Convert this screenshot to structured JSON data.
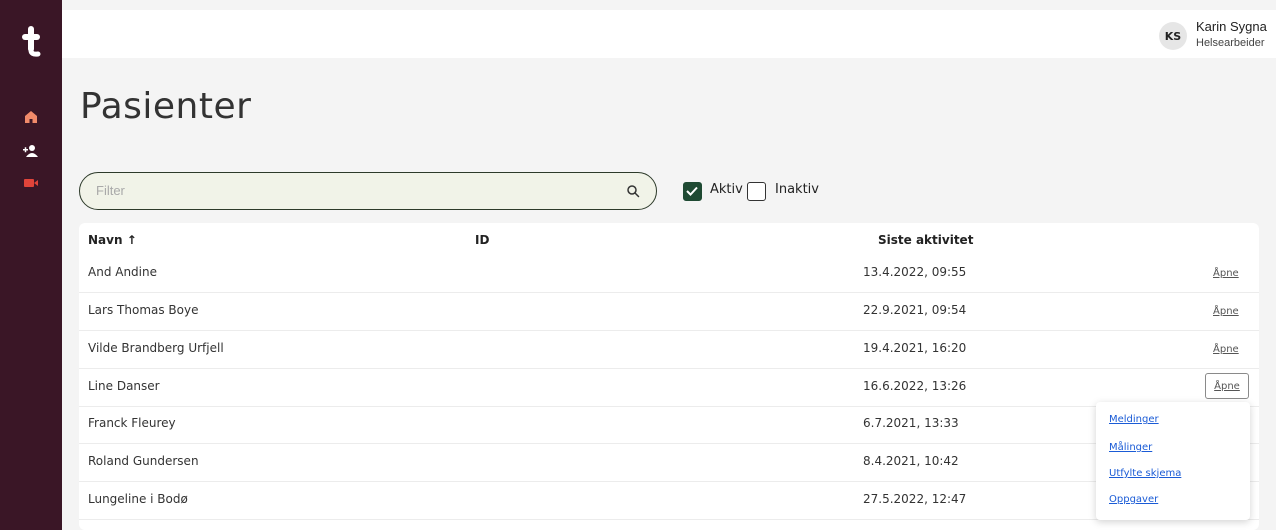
{
  "sidebar": {
    "logo": "treat-logo",
    "items": [
      {
        "icon": "home-icon",
        "color": "#f08a6a"
      },
      {
        "icon": "patients-icon",
        "color": "#ffffff"
      },
      {
        "icon": "video-icon",
        "color": "#e0443a"
      }
    ]
  },
  "user": {
    "initials": "KS",
    "name": "Karin Sygna",
    "role": "Helsearbeider"
  },
  "page": {
    "title": "Pasienter"
  },
  "search": {
    "placeholder": "Filter"
  },
  "filters": {
    "active": {
      "label": "Aktiv",
      "checked": true
    },
    "inactive": {
      "label": "Inaktiv",
      "checked": false
    }
  },
  "table": {
    "headers": {
      "name": "Navn",
      "id": "ID",
      "activity": "Siste aktivitet"
    },
    "rows": [
      {
        "name": "And Andine",
        "activity": "13.4.2022, 09:55",
        "action": "Åpne"
      },
      {
        "name": "Lars Thomas Boye",
        "activity": "22.9.2021, 09:54",
        "action": "Åpne"
      },
      {
        "name": "Vilde Brandberg Urfjell",
        "activity": "19.4.2021, 16:20",
        "action": "Åpne"
      },
      {
        "name": "Line Danser",
        "activity": "16.6.2022, 13:26",
        "action": "Åpne"
      },
      {
        "name": "Franck Fleurey",
        "activity": "6.7.2021, 13:33"
      },
      {
        "name": "Roland Gundersen",
        "activity": "8.4.2021, 10:42"
      },
      {
        "name": "Lungeline i Bodø",
        "activity": "27.5.2022, 12:47"
      }
    ]
  },
  "open_menu": {
    "items": [
      "Meldinger",
      "Målinger",
      "Utfylte skjema",
      "Oppgaver"
    ]
  },
  "colors": {
    "sidebar": "#3a1626",
    "accent_green": "#1f4a33",
    "link_blue": "#1a5bd6"
  }
}
